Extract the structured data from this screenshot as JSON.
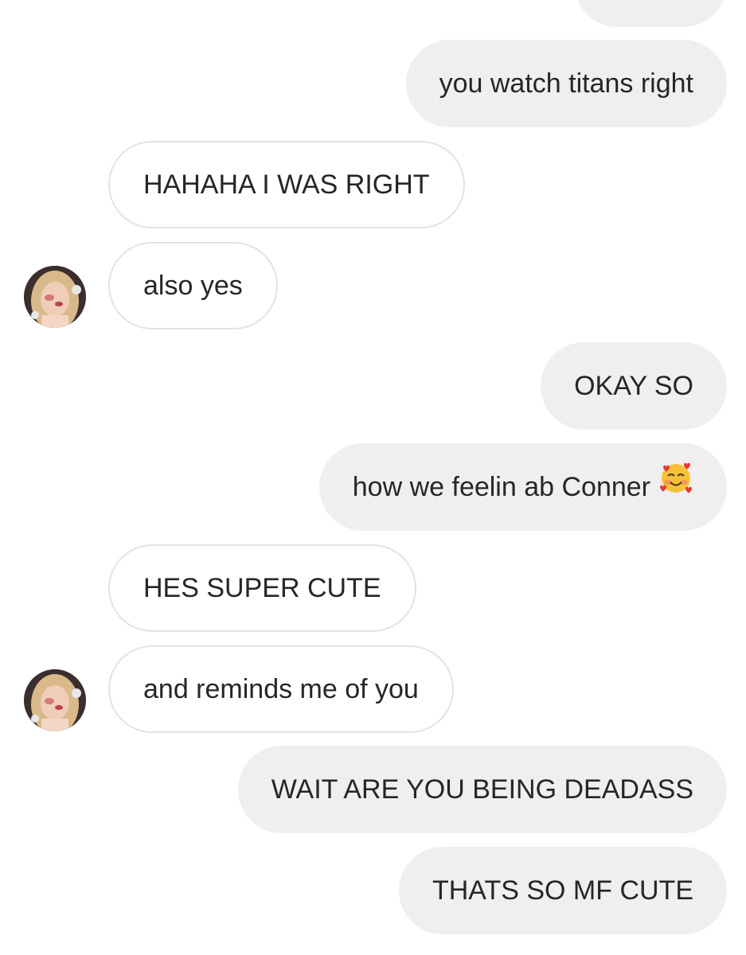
{
  "conversation": {
    "messages": [
      {
        "id": "m0",
        "direction": "sent",
        "text": ""
      },
      {
        "id": "m1",
        "direction": "sent",
        "text": "you watch titans right"
      },
      {
        "id": "m2",
        "direction": "received",
        "text": "HAHAHA I WAS RIGHT"
      },
      {
        "id": "m3",
        "direction": "received",
        "text": "also yes",
        "avatar": true
      },
      {
        "id": "m4",
        "direction": "sent",
        "text": "OKAY SO"
      },
      {
        "id": "m5",
        "direction": "sent",
        "text": "how we feelin ab Conner",
        "emoji": "smiling-face-with-hearts-icon"
      },
      {
        "id": "m6",
        "direction": "received",
        "text": "HES SUPER CUTE"
      },
      {
        "id": "m7",
        "direction": "received",
        "text": "and reminds me of you",
        "avatar": true
      },
      {
        "id": "m8",
        "direction": "sent",
        "text": "WAIT ARE YOU BEING DEADASS"
      },
      {
        "id": "m9",
        "direction": "sent",
        "text": "THATS SO MF CUTE"
      }
    ]
  },
  "colors": {
    "sent_bubble": "#efefef",
    "received_bubble": "#ffffff",
    "received_border": "#e3e3e3",
    "text": "#262626"
  }
}
